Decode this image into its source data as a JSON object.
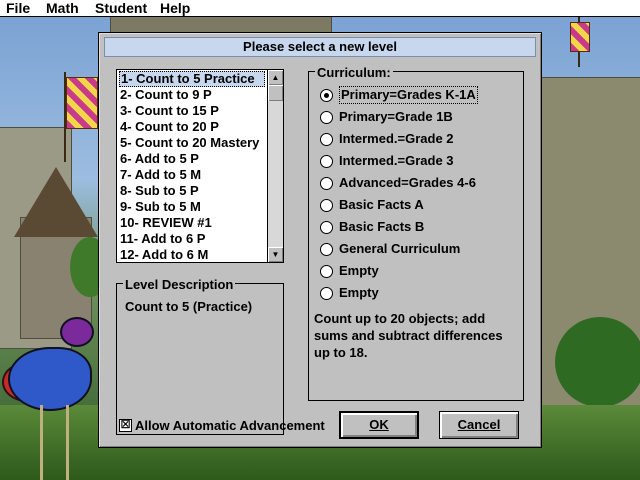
{
  "menu": [
    {
      "label": "File"
    },
    {
      "label": "Math"
    },
    {
      "label": "Student"
    },
    {
      "label": "Help"
    }
  ],
  "dialog": {
    "title": "Please select a new level",
    "levels": [
      "1- Count to 5 Practice",
      "2- Count to 9 P",
      "3- Count to 15 P",
      "4- Count to 20 P",
      "5- Count to 20 Mastery",
      "6- Add to 5 P",
      "7- Add to 5 M",
      "8- Sub to 5 P",
      "9- Sub to 5 M",
      "10- REVIEW #1",
      "11- Add to 6 P",
      "12- Add to 6 M"
    ],
    "selected_level_index": 0,
    "level_description": {
      "label": "Level Description",
      "text": "Count to 5 (Practice)"
    },
    "curriculum": {
      "label": "Curriculum:",
      "options": [
        "Primary=Grades K-1A",
        "Primary=Grade 1B",
        "Intermed.=Grade 2",
        "Intermed.=Grade 3",
        "Advanced=Grades 4-6",
        "Basic Facts A",
        "Basic Facts B",
        "General Curriculum",
        "Empty",
        "Empty"
      ],
      "selected_index": 0,
      "description": "Count up to 20 objects; add sums and subtract differences up to 18."
    },
    "auto_advance": {
      "label": "Allow Automatic Advancement",
      "checked": true,
      "mark": "☒"
    },
    "ok_label": "OK",
    "cancel_label": "Cancel"
  },
  "icons": {
    "scroll_up": "▲",
    "scroll_down": "▼"
  }
}
